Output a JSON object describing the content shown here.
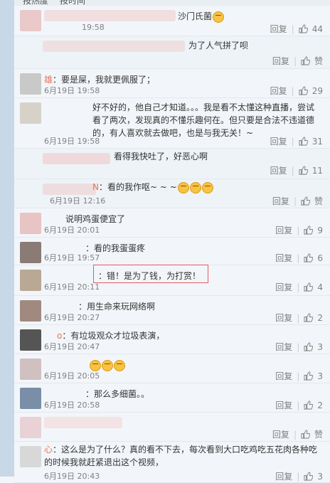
{
  "tabs": {
    "hot": "按热度",
    "time": "按时间"
  },
  "reply_label": "回复",
  "like_label": "赞",
  "comments": [
    {
      "name": "",
      "text": "沙门氏菌",
      "emoji_count": 1,
      "time": "19:58",
      "likes": "44"
    },
    {
      "name": "",
      "text": "为了人气拼了呗",
      "emoji_count": 0,
      "time": "",
      "likes": "赞"
    },
    {
      "name": "雄",
      "text": "要是屎，我就更佩服了；",
      "emoji_count": 0,
      "time": "6月19日 19:58",
      "likes": "29"
    },
    {
      "name": "",
      "text": "好不好的，他自己才知道。。。我是看不太懂这种直播，尝试看了两次，发现真的不懂乐趣何在。但只要是合法不违道德的，有人喜欢就去做吧，也是与我无关！~",
      "emoji_count": 0,
      "time": "6月19日 19:58",
      "likes": "31"
    },
    {
      "name": "",
      "text": "看得我快吐了，好恶心啊",
      "emoji_count": 0,
      "time": "",
      "likes": "11"
    },
    {
      "name": "N",
      "text": "看的我作呕~ ~ ~",
      "emoji_count": 3,
      "time": "6月19日 12:16",
      "likes": "赞"
    },
    {
      "name": "",
      "text": "说明鸡蛋便宜了",
      "emoji_count": 0,
      "time": "6月19日 20:01",
      "likes": "9"
    },
    {
      "name": "",
      "text": "看的我蛋蛋疼",
      "emoji_count": 0,
      "time": "6月19日 19:57",
      "likes": "6"
    },
    {
      "name": "",
      "text": "错！是为了钱，为打赏！",
      "emoji_count": 0,
      "time": "6月19日 20:11",
      "likes": "4"
    },
    {
      "name": "",
      "text": "用生命来玩网络啊",
      "emoji_count": 0,
      "time": "6月19日 20:27",
      "likes": "2"
    },
    {
      "name": "o",
      "text": "有垃圾观众才垃圾表演，",
      "emoji_count": 0,
      "time": "6月19日 20:47",
      "likes": "3"
    },
    {
      "name": "",
      "text": "",
      "emoji_count": 3,
      "time": "6月19日 20:05",
      "likes": "3"
    },
    {
      "name": "",
      "text": "那么多细菌。。",
      "emoji_count": 0,
      "time": "6月19日 20:58",
      "likes": "2"
    },
    {
      "name": "",
      "text": "",
      "emoji_count": 0,
      "time": "",
      "likes": "赞"
    },
    {
      "name": "心",
      "text": "这么是为了什么？真的看不下去，每次看到大口吃鸡吃五花肉各种吃的时候我就赶紧退出这个视频，",
      "emoji_count": 0,
      "time": "6月19日 20:43",
      "likes": "3"
    }
  ],
  "colors": {
    "accent": "#eb7350",
    "page_bg": "#f2f6fa",
    "box": "#e45b5b"
  }
}
